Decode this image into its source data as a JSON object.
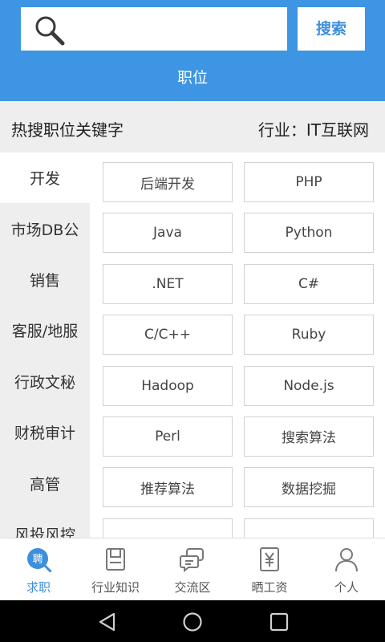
{
  "header": {
    "search_placeholder": "",
    "search_button": "搜索",
    "title": "职位"
  },
  "keywords": {
    "title": "热搜职位关键字",
    "industry": "行业：IT互联网"
  },
  "sidebar": {
    "items": [
      {
        "label": "开发",
        "active": true
      },
      {
        "label": "市场DB公",
        "active": false
      },
      {
        "label": "销售",
        "active": false
      },
      {
        "label": "客服/地服",
        "active": false
      },
      {
        "label": "行政文秘",
        "active": false
      },
      {
        "label": "财税审计",
        "active": false
      },
      {
        "label": "高管",
        "active": false
      },
      {
        "label": "风投风控",
        "active": false
      }
    ]
  },
  "tags": [
    [
      "后端开发",
      "PHP"
    ],
    [
      "Java",
      "Python"
    ],
    [
      ".NET",
      "C#"
    ],
    [
      "C/C++",
      "Ruby"
    ],
    [
      "Hadoop",
      "Node.js"
    ],
    [
      "Perl",
      "搜索算法"
    ],
    [
      "推荐算法",
      "数据挖掘"
    ],
    [
      "",
      ""
    ]
  ],
  "tabbar": {
    "tabs": [
      {
        "label": "求职",
        "icon": "job-icon",
        "active": true
      },
      {
        "label": "行业知识",
        "icon": "book-icon",
        "active": false
      },
      {
        "label": "交流区",
        "icon": "chat-icon",
        "active": false
      },
      {
        "label": "晒工资",
        "icon": "salary-icon",
        "active": false
      },
      {
        "label": "个人",
        "icon": "person-icon",
        "active": false
      }
    ],
    "job_icon_text": "聘"
  },
  "colors": {
    "accent": "#3d95e3",
    "sidebar_bg": "#eeeeee"
  }
}
